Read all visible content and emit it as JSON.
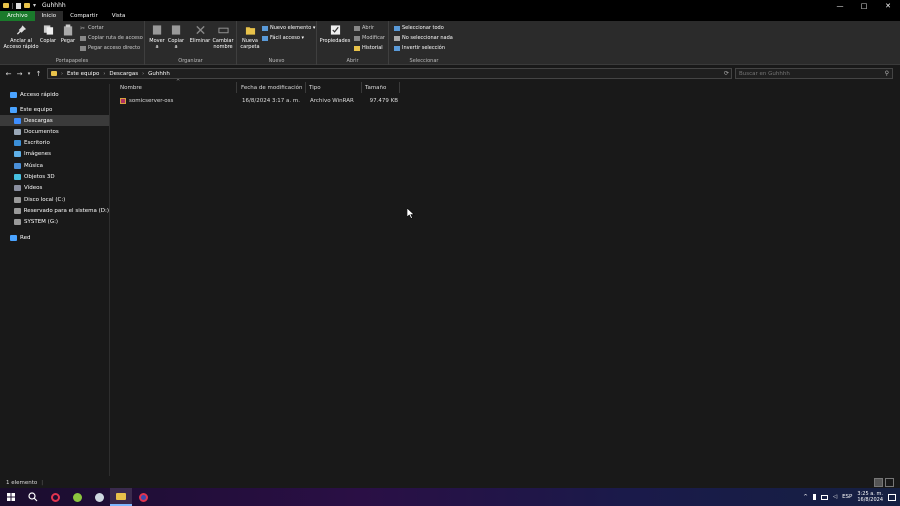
{
  "window": {
    "title": "Guhhhh",
    "controls": {
      "minimize": "—",
      "maximize": "□",
      "close": "✕"
    },
    "qat_dropdown": "▾"
  },
  "ribbon_tabs": [
    {
      "label": "Archivo"
    },
    {
      "label": "Inicio"
    },
    {
      "label": "Compartir"
    },
    {
      "label": "Vista"
    }
  ],
  "ribbon": {
    "portapapeles": {
      "label": "Portapapeles",
      "anclar": "Anclar al\nAcceso rápido",
      "copiar": "Copiar",
      "pegar": "Pegar",
      "cortar": "Cortar",
      "copiar_ruta": "Copiar ruta de acceso",
      "pegar_acceso": "Pegar acceso directo"
    },
    "organizar": {
      "label": "Organizar",
      "mover": "Mover\na",
      "copiar_a": "Copiar\na",
      "eliminar": "Eliminar",
      "cambiar_nombre": "Cambiar\nnombre"
    },
    "nuevo": {
      "label": "Nuevo",
      "nueva_carpeta": "Nueva\ncarpeta",
      "nuevo_elemento": "Nuevo elemento ▾",
      "facil_acceso": "Fácil acceso ▾"
    },
    "abrir": {
      "label": "Abrir",
      "propiedades": "Propiedades",
      "abrir": "Abrir",
      "modificar": "Modificar",
      "historial": "Historial"
    },
    "seleccionar": {
      "label": "Seleccionar",
      "todo": "Seleccionar todo",
      "nada": "No seleccionar nada",
      "invertir": "Invertir selección"
    }
  },
  "address": {
    "crumbs": [
      "Este equipo",
      "Descargas",
      "Guhhhh"
    ],
    "search_placeholder": "Buscar en Guhhhh"
  },
  "nav": {
    "items": [
      {
        "label": "Acceso rápido",
        "color": "#4aa3ff"
      },
      {
        "label": "Este equipo",
        "color": "#4aa3ff"
      },
      {
        "label": "Descargas",
        "color": "#3e8eff"
      },
      {
        "label": "Documentos",
        "color": "#9aa8b8"
      },
      {
        "label": "Escritorio",
        "color": "#3b8fd8"
      },
      {
        "label": "Imágenes",
        "color": "#5fb0e8"
      },
      {
        "label": "Música",
        "color": "#4a90d9"
      },
      {
        "label": "Objetos 3D",
        "color": "#47c0e0"
      },
      {
        "label": "Vídeos",
        "color": "#8a8fa0"
      },
      {
        "label": "Disco local (C:)",
        "color": "#9a9a9a"
      },
      {
        "label": "Reservado para el sistema (D:)",
        "color": "#9a9a9a"
      },
      {
        "label": "SYSTEM (G:)",
        "color": "#9a9a9a"
      },
      {
        "label": "Red",
        "color": "#4aa3ff"
      }
    ]
  },
  "columns": {
    "nombre": "Nombre",
    "fecha": "Fecha de modificación",
    "tipo": "Tipo",
    "tamano": "Tamaño"
  },
  "files": [
    {
      "name": "somicserver-oss",
      "date": "16/8/2024 3:17 a. m.",
      "type": "Archivo WinRAR",
      "size": "97.479 KB"
    }
  ],
  "status": {
    "count": "1 elemento"
  },
  "taskbar": {
    "lang": "ESP",
    "time": "3:25 a. m.",
    "date": "16/8/2024"
  }
}
